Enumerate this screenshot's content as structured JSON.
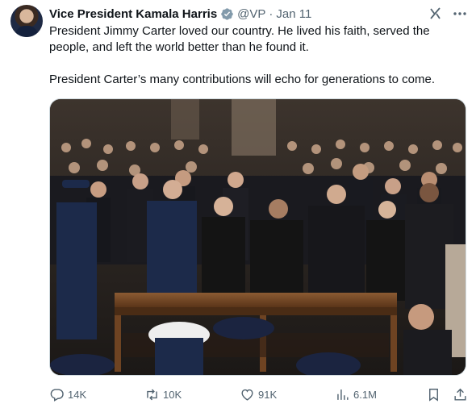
{
  "tweet": {
    "author_name": "Vice President Kamala Harris",
    "handle": "@VP",
    "separator": "·",
    "date": "Jan 11",
    "text_paragraphs": [
      "President Jimmy Carter loved our country. He lived his faith, served the people, and left the world better than he found it.",
      "President Carter’s many contributions will echo for generations to come."
    ],
    "verified_badge": "gray-check-icon",
    "media": {
      "icon": "photo",
      "palette": {
        "wood": "#7a4f2c",
        "suit_navy": "#1c2a4a",
        "suit_black": "#141414",
        "crowd": "#2e2722",
        "stone": "#8a7a68"
      }
    }
  },
  "actions": {
    "replies": "14K",
    "reposts": "10K",
    "likes": "91K",
    "views": "6.1M"
  },
  "colors": {
    "text_primary": "#0f1419",
    "text_secondary": "#536471",
    "border": "#cfd9de",
    "badge_gray": "#829aab"
  }
}
